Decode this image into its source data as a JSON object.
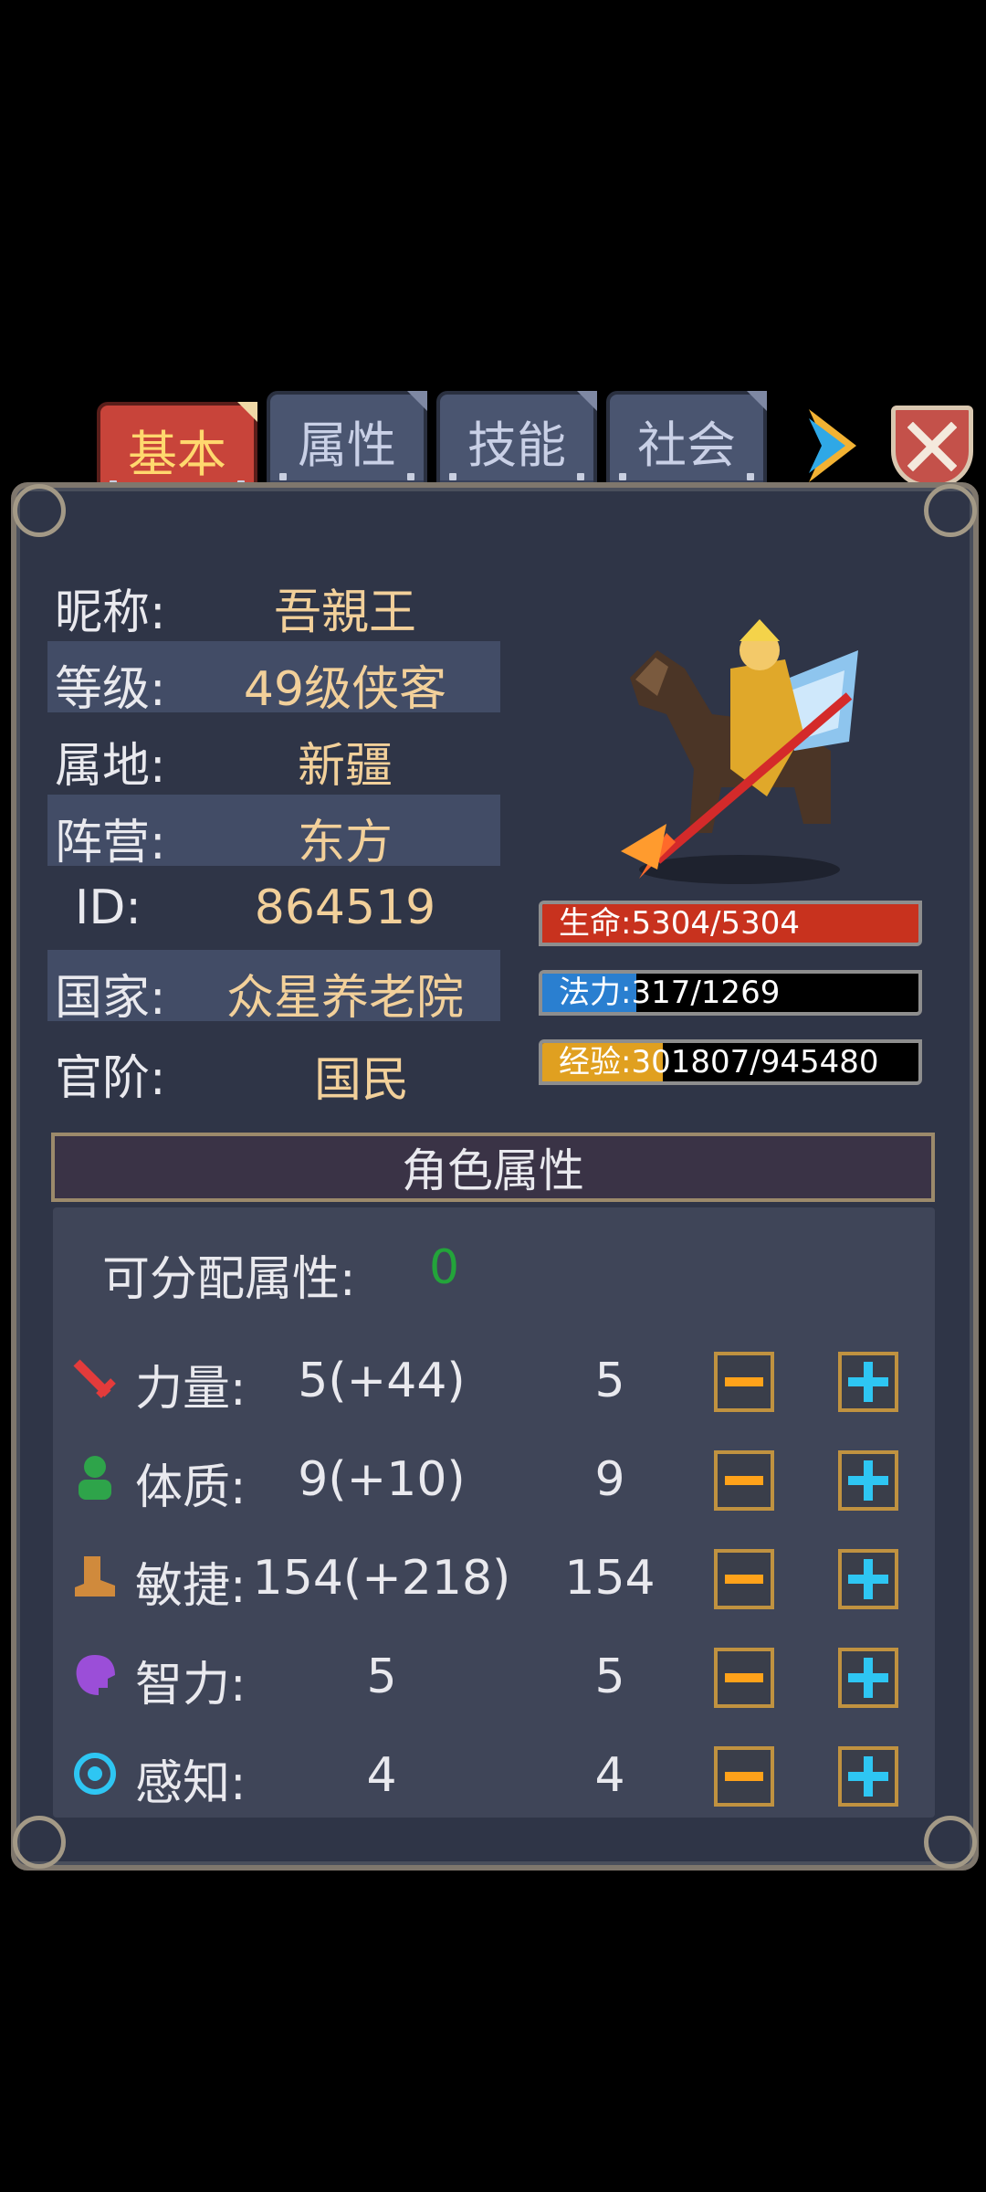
{
  "tabs": [
    {
      "label": "基本",
      "active": true
    },
    {
      "label": "属性",
      "active": false
    },
    {
      "label": "技能",
      "active": false
    },
    {
      "label": "社会",
      "active": false
    }
  ],
  "info": {
    "nickname_label": "昵称:",
    "nickname": "吾親王",
    "level_label": "等级:",
    "level": "49级侠客",
    "territory_label": "属地:",
    "territory": "新疆",
    "faction_label": "阵营:",
    "faction": "东方",
    "id_label": "ID:",
    "id": "864519",
    "country_label": "国家:",
    "country": "众星养老院",
    "rank_label": "官阶:",
    "rank": "国民"
  },
  "bars": {
    "hp": {
      "text": "生命:5304/5304",
      "fraction": 1.0,
      "color": "#c8321e"
    },
    "mp": {
      "text": "法力:317/1269",
      "fraction": 0.25,
      "color": "#2a7fd0"
    },
    "exp": {
      "text": "经验:301807/945480",
      "fraction": 0.32,
      "color": "#e0a020"
    }
  },
  "attributes": {
    "section_title": "角色属性",
    "points_label": "可分配属性:",
    "points_value": "0",
    "rows": [
      {
        "label": "力量:",
        "total": "5(+44)",
        "base": "5",
        "icon": "sword-icon"
      },
      {
        "label": "体质:",
        "total": "9(+10)",
        "base": "9",
        "icon": "body-icon"
      },
      {
        "label": "敏捷:",
        "total": "154(+218)",
        "base": "154",
        "icon": "boot-icon"
      },
      {
        "label": "智力:",
        "total": "5",
        "base": "5",
        "icon": "brain-icon"
      },
      {
        "label": "感知:",
        "total": "4",
        "base": "4",
        "icon": "eye-icon"
      }
    ]
  },
  "colors": {
    "accent_gold": "#f2d09a",
    "points_green": "#23a43a",
    "plus_blue": "#2ec6f3",
    "minus_orange": "#ffa21a"
  }
}
